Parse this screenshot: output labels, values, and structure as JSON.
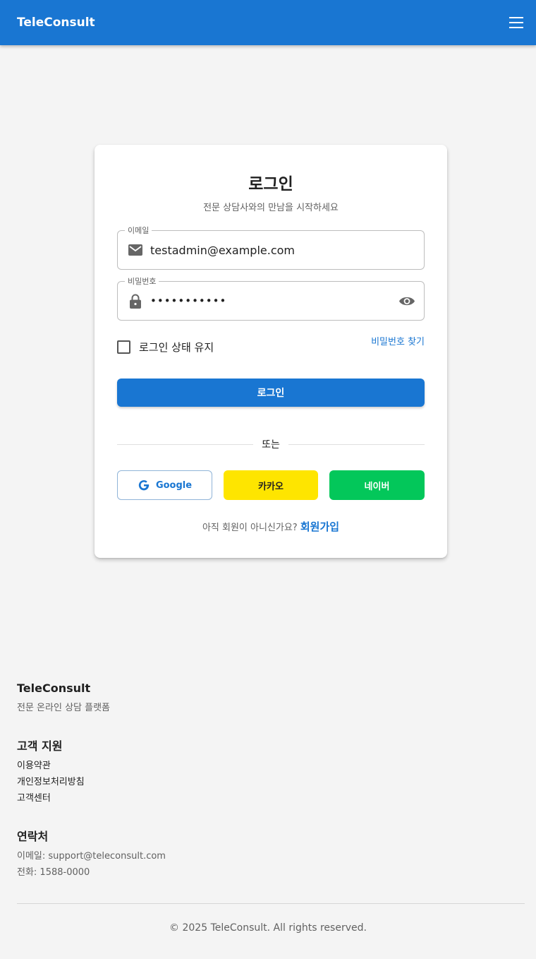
{
  "header": {
    "brand": "TeleConsult"
  },
  "login": {
    "title": "로그인",
    "subtitle": "전문 상담사와의 만남을 시작하세요",
    "email": {
      "label": "이메일",
      "value": "testadmin@example.com"
    },
    "password": {
      "label": "비밀번호",
      "value": "•••••••••••"
    },
    "remember_label": "로그인 상태 유지",
    "forgot_label": "비밀번호 찾기",
    "submit_label": "로그인",
    "divider_label": "또는",
    "social": {
      "google": "Google",
      "kakao": "카카오",
      "naver": "네이버"
    },
    "signup_prompt": "아직 회원이 아니신가요? ",
    "signup_link": "회원가입"
  },
  "footer": {
    "brand": "TeleConsult",
    "tagline": "전문 온라인 상담 플랫폼",
    "support_title": "고객 지원",
    "support_links": [
      "이용약관",
      "개인정보처리방침",
      "고객센터"
    ],
    "contact_title": "연락처",
    "contact_email": "이메일: support@teleconsult.com",
    "contact_phone": "전화: 1588-0000",
    "copyright": "© 2025 TeleConsult. All rights reserved."
  },
  "colors": {
    "primary": "#1976d2",
    "kakao": "#fee500",
    "naver": "#03c75a",
    "background": "#f4f4f4"
  },
  "icons": [
    "menu-icon",
    "mail-icon",
    "lock-icon",
    "eye-icon",
    "google-icon"
  ]
}
